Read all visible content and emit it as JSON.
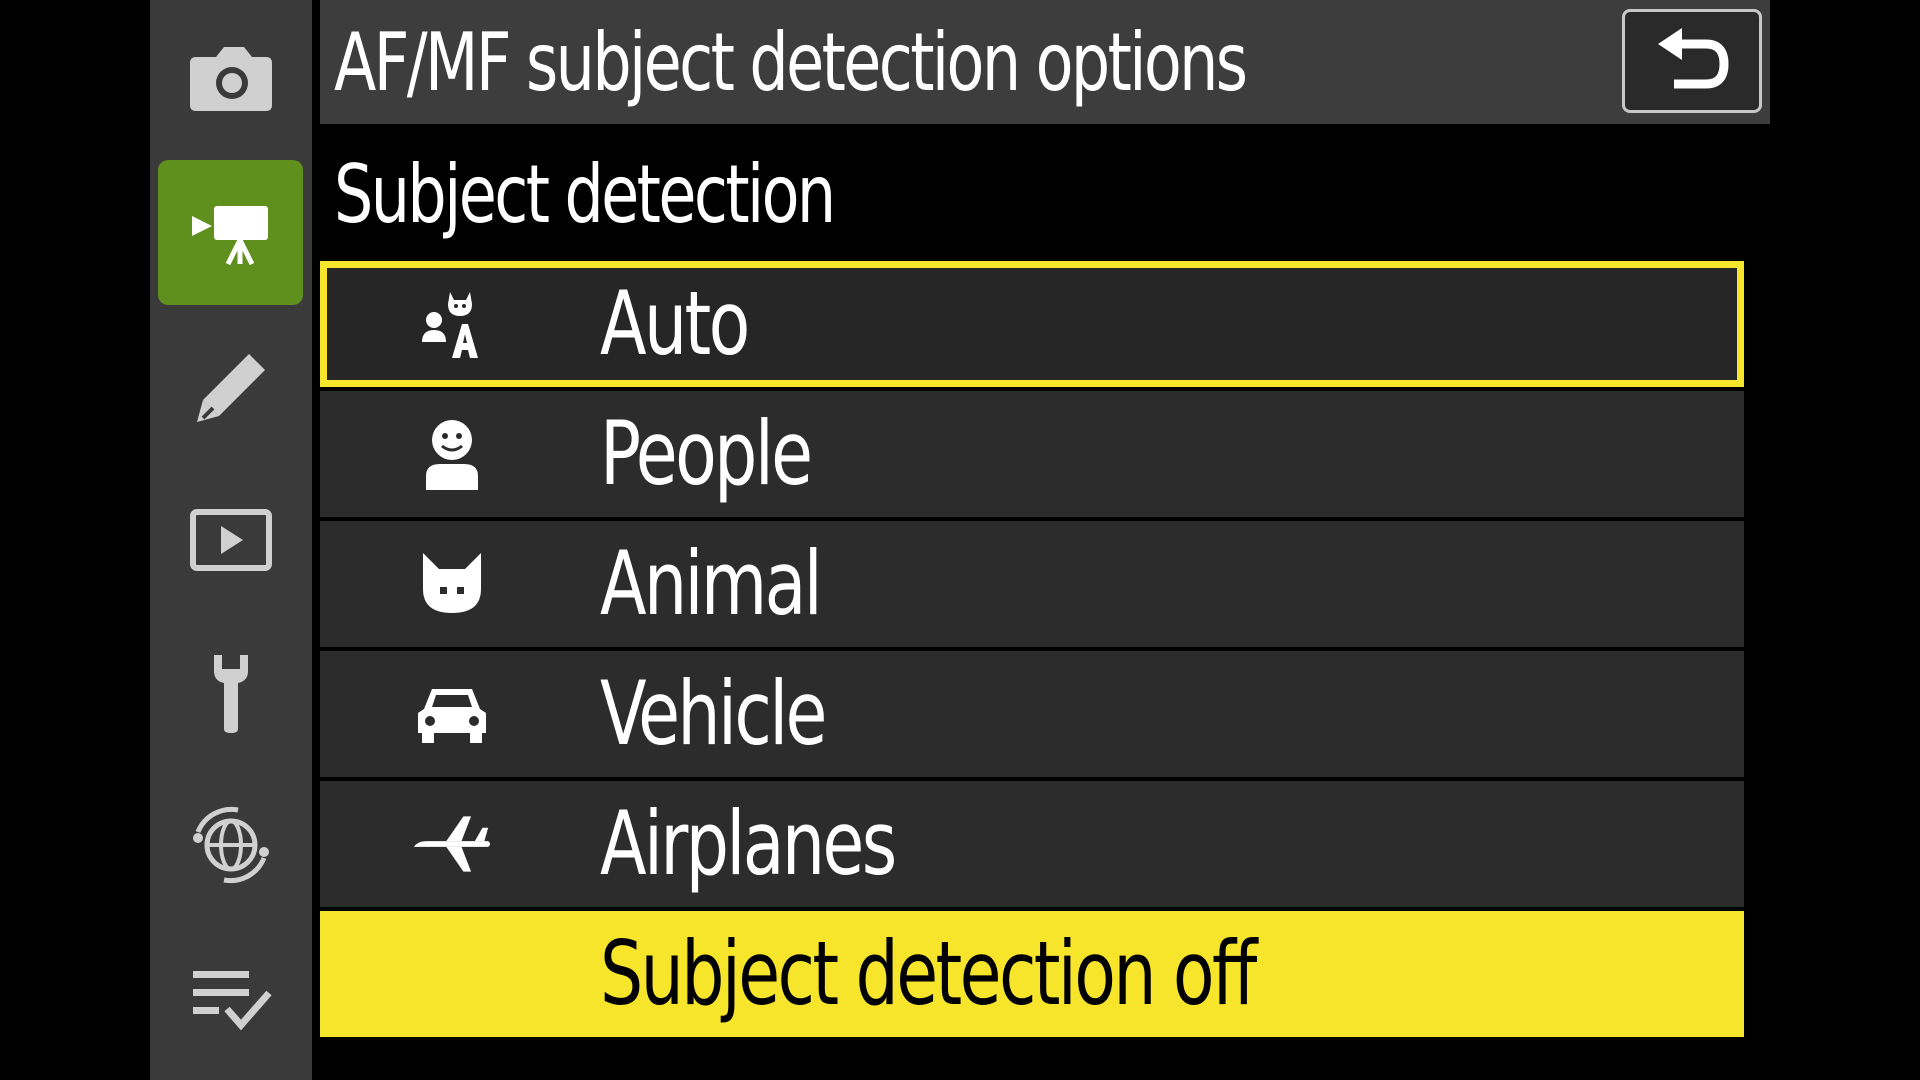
{
  "header": {
    "title": "AF/MF subject detection options"
  },
  "section": {
    "heading": "Subject detection"
  },
  "rail": {
    "tabs": [
      {
        "icon": "camera-icon",
        "active": false
      },
      {
        "icon": "movie-camera-icon",
        "active": true
      },
      {
        "icon": "pencil-icon",
        "active": false
      },
      {
        "icon": "playback-icon",
        "active": false
      },
      {
        "icon": "wrench-icon",
        "active": false
      },
      {
        "icon": "network-icon",
        "active": false
      },
      {
        "icon": "my-menu-icon",
        "active": false
      }
    ]
  },
  "options": [
    {
      "label": "Auto",
      "icon": "auto-detect-icon",
      "state": "focused"
    },
    {
      "label": "People",
      "icon": "person-icon",
      "state": "normal"
    },
    {
      "label": "Animal",
      "icon": "animal-icon",
      "state": "normal"
    },
    {
      "label": "Vehicle",
      "icon": "vehicle-icon",
      "state": "normal"
    },
    {
      "label": "Airplanes",
      "icon": "airplane-icon",
      "state": "normal"
    },
    {
      "label": "Subject detection off",
      "icon": "",
      "state": "selected"
    }
  ],
  "colors": {
    "highlight": "#f7e52b",
    "active_tab": "#5f8f1c",
    "rail": "#3a3a3a",
    "row": "#2c2c2c"
  }
}
